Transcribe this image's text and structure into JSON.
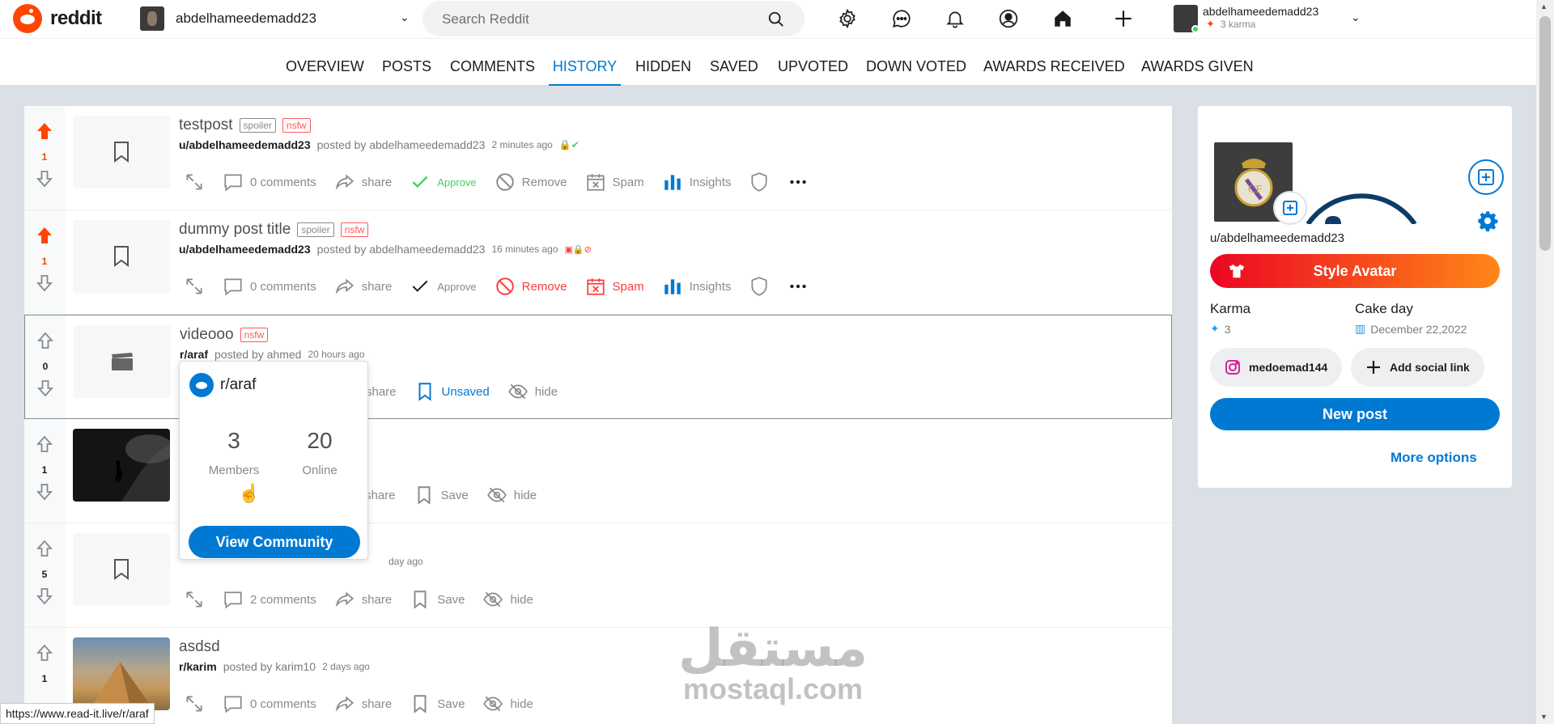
{
  "header": {
    "logo_text": "reddit",
    "current_user": "abdelhameedemadd23",
    "search_placeholder": "Search Reddit",
    "account_name": "abdelhameedemadd23",
    "account_karma": "3 karma"
  },
  "tabs": [
    {
      "label": "OVERVIEW",
      "active": false
    },
    {
      "label": "POSTS",
      "active": false
    },
    {
      "label": "COMMENTS",
      "active": false
    },
    {
      "label": "HISTORY",
      "active": true
    },
    {
      "label": "HIDDEN",
      "active": false
    },
    {
      "label": "SAVED",
      "active": false
    },
    {
      "label": "UPVOTED",
      "active": false
    },
    {
      "label": "DOWN VOTED",
      "active": false
    },
    {
      "label": "AWARDS RECEIVED",
      "active": false
    },
    {
      "label": "AWARDS GIVEN",
      "active": false
    }
  ],
  "posts": [
    {
      "votes": "1",
      "upvoted": true,
      "thumb": "bookmark-icon",
      "title": "testpost",
      "tags": [
        "spoiler",
        "nsfw"
      ],
      "sub": "u/abdelhameedemadd23",
      "posted_by": "posted by abdelhameedemadd23",
      "time": "2 minutes ago",
      "comments": "0 comments",
      "share": "share",
      "approve": "Approve",
      "remove": "Remove",
      "spam": "Spam",
      "insights": "Insights"
    },
    {
      "votes": "1",
      "upvoted": true,
      "thumb": "bookmark-icon",
      "title": "dummy post title",
      "tags": [
        "spoiler",
        "nsfw"
      ],
      "sub": "u/abdelhameedemadd23",
      "posted_by": "posted by abdelhameedemadd23",
      "time": "16 minutes ago",
      "comments": "0 comments",
      "share": "share",
      "approve": "Approve",
      "remove": "Remove",
      "spam": "Spam",
      "insights": "Insights"
    },
    {
      "votes": "0",
      "upvoted": false,
      "thumb": "clapperboard-icon",
      "title": "videooo",
      "tags": [
        "nsfw"
      ],
      "sub": "r/araf",
      "posted_by": "posted by ahmed",
      "time": "20 hours ago",
      "share": "share",
      "save": "Unsaved",
      "hide": "hide"
    },
    {
      "votes": "1",
      "upvoted": false,
      "thumb": "photo",
      "title": "",
      "tags": [],
      "sub": "",
      "posted_by": "",
      "time": "",
      "share": "share",
      "save": "Save",
      "hide": "hide"
    },
    {
      "votes": "5",
      "upvoted": false,
      "thumb": "bookmark-icon",
      "title": "",
      "tags": [],
      "sub": "",
      "posted_by": "",
      "time": "day ago",
      "comments": "2 comments",
      "share": "share",
      "save": "Save",
      "hide": "hide"
    },
    {
      "votes": "1",
      "upvoted": false,
      "thumb": "pyramid-photo",
      "title": "asdsd",
      "tags": [],
      "sub": "r/karim",
      "posted_by": "posted by karim10",
      "time": "2 days ago",
      "comments": "0 comments",
      "share": "share",
      "save": "Save",
      "hide": "hide"
    }
  ],
  "popover": {
    "name": "r/araf",
    "members_value": "3",
    "members_label": "Members",
    "online_value": "20",
    "online_label": "Online",
    "button": "View Community"
  },
  "sidebar": {
    "username": "u/abdelhameedemadd23",
    "style_avatar": "Style Avatar",
    "karma_label": "Karma",
    "karma_value": "3",
    "cakeday_label": "Cake day",
    "cakeday_value": "December 22,2022",
    "instagram": "medoemad144",
    "add_social": "Add social link",
    "new_post": "New post",
    "more_options": "More options"
  },
  "status_url": "https://www.read-it.live/r/araf",
  "watermark": {
    "arabic": "مستقل",
    "latin": "mostaql.com"
  },
  "colors": {
    "accent": "#0079d3",
    "upvote": "#ff4500",
    "approve": "#46d160",
    "danger": "#ff3b3b"
  }
}
